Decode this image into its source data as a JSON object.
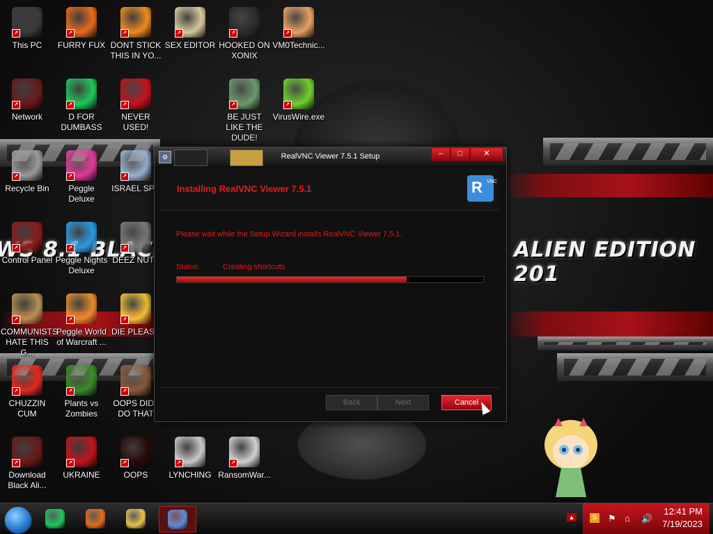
{
  "desktop": {
    "banner_left": "WS 8.1 BLACK",
    "banner_right": "ALIEN EDITION 201",
    "icons": [
      {
        "label": "This PC",
        "icon": "computer-icon",
        "color": "#3a3a3a"
      },
      {
        "label": "FURRY FUX",
        "icon": "firefox-icon",
        "color": "#e86b1a"
      },
      {
        "label": "DONT STICK THIS IN YO...",
        "icon": "vlc-cone-icon",
        "color": "#f08a1c"
      },
      {
        "label": "SEX EDITOR",
        "icon": "hxd-icon",
        "color": "#d8c79b"
      },
      {
        "label": "HOOKED ON XONIX",
        "icon": "xonix-game-icon",
        "color": "#2a2a2a"
      },
      {
        "label": "VM0Technic...",
        "icon": "doctor-avatar-icon",
        "color": "#e8a060"
      },
      {
        "label": "Network",
        "icon": "alien-network-icon",
        "color": "#6a1a1a"
      },
      {
        "label": "D FOR DUMBASS",
        "icon": "spotify-like-icon",
        "color": "#1ec75a"
      },
      {
        "label": "NEVER USED!",
        "icon": "devcpp-icon",
        "color": "#c4121a"
      },
      {
        "label": "BE JUST LIKE THE DUDE!",
        "icon": "gnome-dude-icon",
        "color": "#6a9a6a"
      },
      {
        "label": "VirusWire.exe",
        "icon": "limewire-icon",
        "color": "#6ed02a"
      },
      {
        "label": "Recycle Bin",
        "icon": "recycle-bin-icon",
        "color": "#9a9a9a"
      },
      {
        "label": "Peggle Deluxe",
        "icon": "peggle-icon",
        "color": "#e23a9a"
      },
      {
        "label": "ISRAEL SPY",
        "icon": "network-pc-icon",
        "color": "#9ab0d0"
      },
      {
        "label": "Control Panel",
        "icon": "control-panel-icon",
        "color": "#8a1a1a"
      },
      {
        "label": "Peggle Nights Deluxe",
        "icon": "peggle-nights-icon",
        "color": "#2a9ae2"
      },
      {
        "label": "DEEZ NUTZ",
        "icon": "copy-pages-icon",
        "color": "#7a7a7a"
      },
      {
        "label": "COMMUNISTS HATE THIS G...",
        "icon": "money-bag-icon",
        "color": "#b89050"
      },
      {
        "label": "Peggle World of Warcraft ...",
        "icon": "peggle-wow-icon",
        "color": "#e88a2a"
      },
      {
        "label": "DIE PLEASE",
        "icon": "de-logo-icon",
        "color": "#f2c233"
      },
      {
        "label": "CHUZZIN CUM",
        "icon": "chuzzle-icon",
        "color": "#e2281e"
      },
      {
        "label": "Plants vs Zombies",
        "icon": "flower-icon",
        "color": "#3a8a2a"
      },
      {
        "label": "OOPS DID I DO THAT",
        "icon": "portrait-icon",
        "color": "#8a5a3a"
      },
      {
        "label": "Download Black Ali...",
        "icon": "alien-download-icon",
        "color": "#6a1a1a"
      },
      {
        "label": "UKRAINE",
        "icon": "radiation-icon",
        "color": "#c4121a"
      },
      {
        "label": "OOPS",
        "icon": "oops-app-icon",
        "color": "#2a0a0a"
      },
      {
        "label": "LYNCHING",
        "icon": "network-tree-icon",
        "color": "#c8c8c8"
      },
      {
        "label": "RansomWar...",
        "icon": "skull-icon",
        "color": "#d0d0d0"
      }
    ]
  },
  "dialog": {
    "title": "RealVNC Viewer 7.5.1 Setup",
    "heading": "Installing RealVNC Viewer 7.5.1",
    "logo_text": "R",
    "logo_sub": "VNC",
    "message": "Please wait while the Setup Wizard installs RealVNC Viewer 7.5.1.",
    "status_label": "Status:",
    "status_value": "Creating shortcuts",
    "progress": 0.75,
    "buttons": {
      "back": "Back",
      "next": "Next",
      "cancel": "Cancel"
    },
    "window_controls": {
      "minimize": "–",
      "maximize": "□",
      "close": "✕"
    }
  },
  "taskbar": {
    "apps": [
      {
        "name": "spotify-app",
        "icon": "spotify-like-icon",
        "color": "#1ec75a"
      },
      {
        "name": "firefox-app",
        "icon": "firefox-icon",
        "color": "#e86b1a"
      },
      {
        "name": "file-explorer-app",
        "icon": "folder-icon",
        "color": "#e8c24a"
      },
      {
        "name": "setup-app",
        "icon": "installer-icon",
        "color": "#5c8adb"
      }
    ],
    "time": "12:41 PM",
    "date": "7/19/2023"
  },
  "accent": "#e01b1b"
}
